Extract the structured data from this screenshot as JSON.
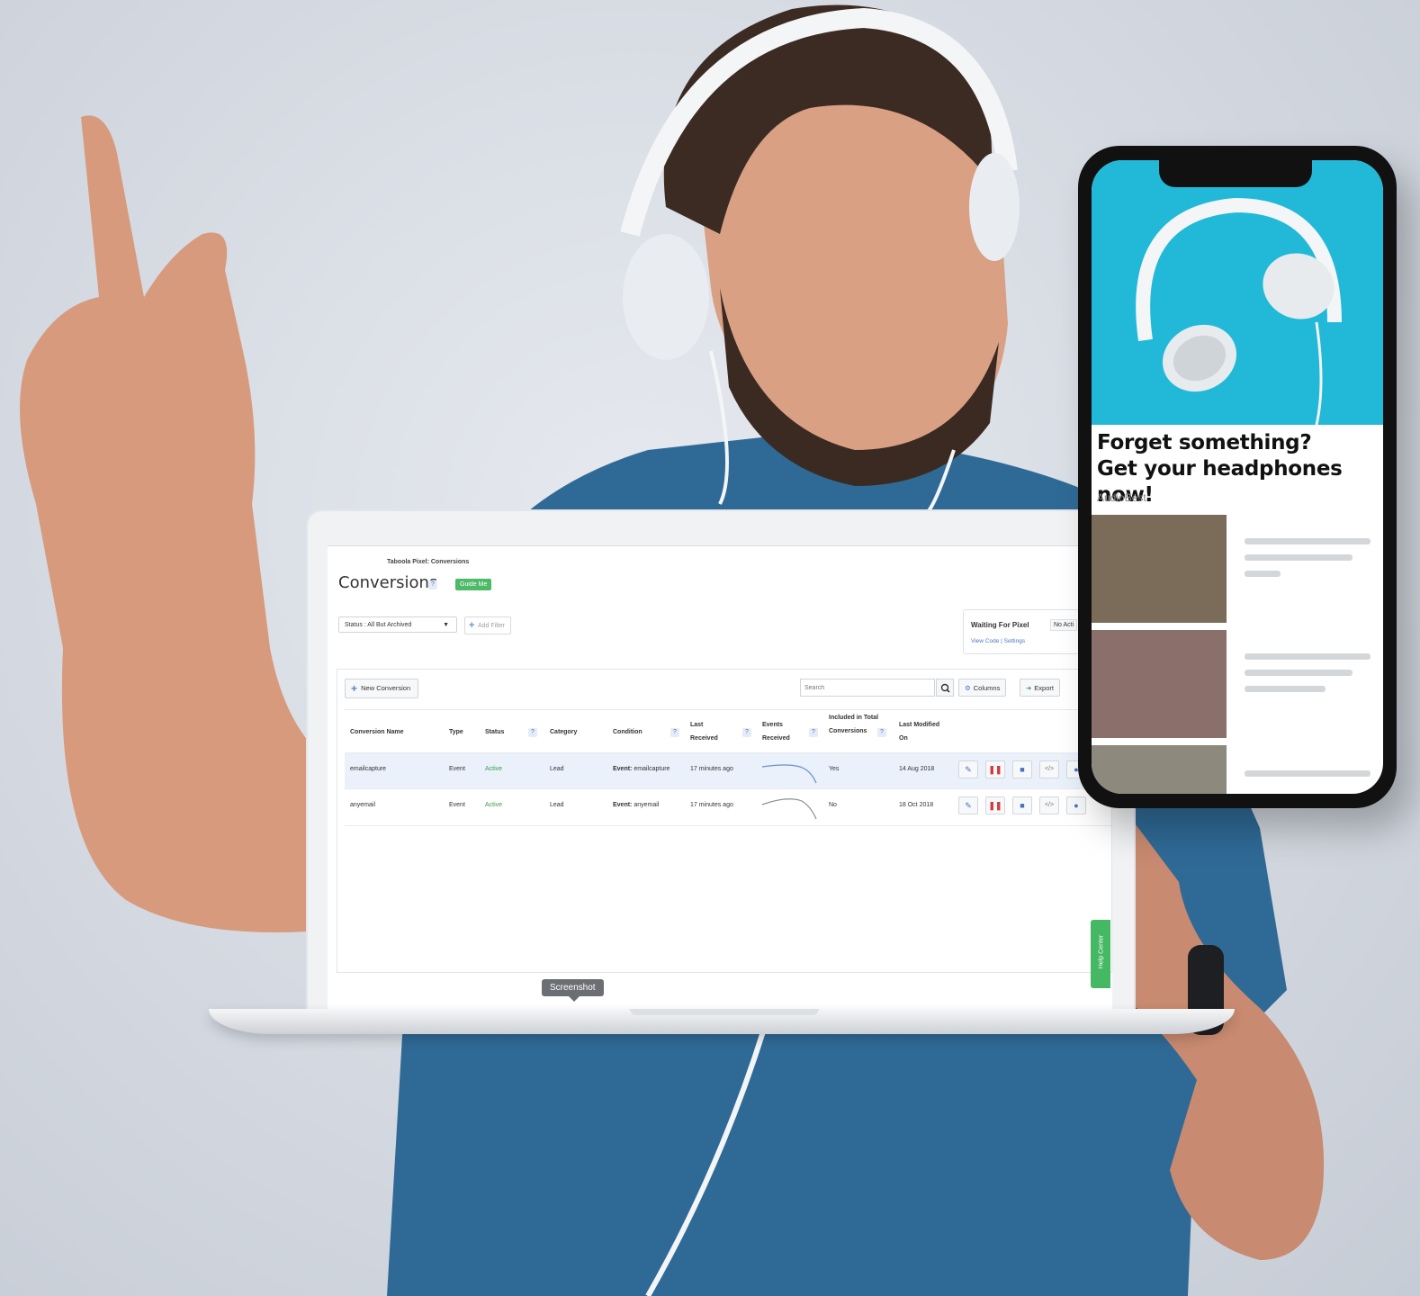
{
  "dashboard": {
    "breadcrumb": "Taboola Pixel: Conversions",
    "title": "Conversions",
    "help_mark": "?",
    "guide_button": "Guide Me",
    "status_filter": "Status : All But Archived",
    "add_filter": "Add Filter",
    "pixel_status": {
      "label": "Waiting For Pixel",
      "value": "No Acti",
      "links": "View Code | Settings"
    },
    "toolbar": {
      "new_conversion": "New Conversion",
      "search_placeholder": "Search",
      "columns": "Columns",
      "export": "Export"
    },
    "columns": [
      "Conversion Name",
      "Type",
      "Status",
      "Category",
      "Condition",
      "Last Received",
      "Events Received",
      "Included in Total Conversions",
      "Last Modified On"
    ],
    "rows": [
      {
        "name": "emailcapture",
        "type": "Event",
        "status": "Active",
        "category": "Lead",
        "condition_label": "Event:",
        "condition_value": "emailcapture",
        "last_received": "17 minutes ago",
        "included": "Yes",
        "modified": "14 Aug 2018"
      },
      {
        "name": "anyemail",
        "type": "Event",
        "status": "Active",
        "category": "Lead",
        "condition_label": "Event:",
        "condition_value": "anyemail",
        "last_received": "17 minutes ago",
        "included": "No",
        "modified": "18 Oct 2018"
      }
    ],
    "help_center": "Help Center",
    "screenshot_tooltip": "Screenshot"
  },
  "phone_ad": {
    "headline_line1": "Forget something?",
    "headline_line2": "Get your headphones now!",
    "source": "AudioBest"
  },
  "colors": {
    "brand_green": "#4cba66",
    "link_blue": "#4a78c2",
    "status_active": "#3c9a4a",
    "hero_cyan": "#22b9d9"
  }
}
